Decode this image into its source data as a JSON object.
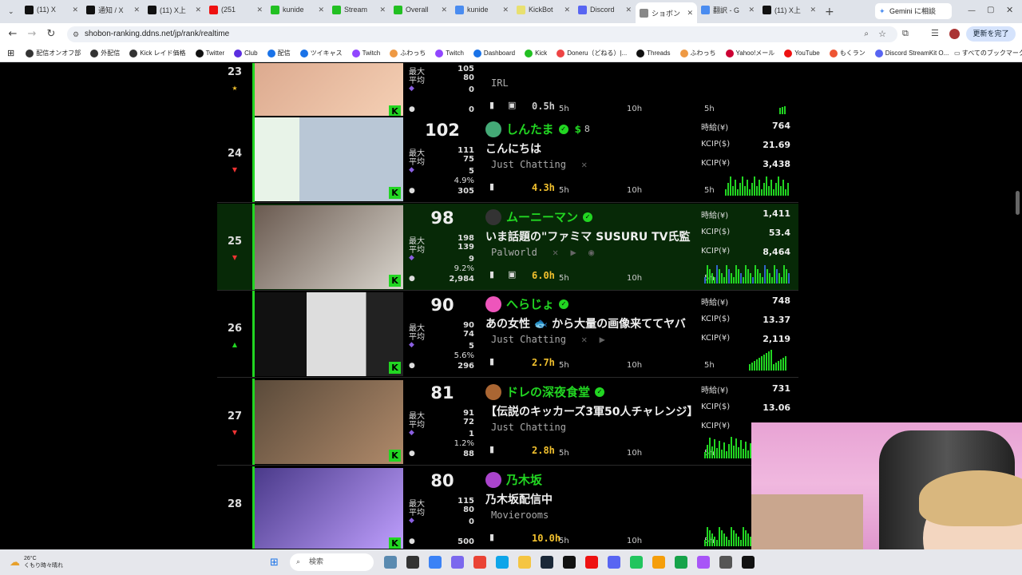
{
  "tabs": [
    {
      "label": "(11) X",
      "icon": "x-icon",
      "color": "#111"
    },
    {
      "label": "通知 / X",
      "icon": "x-icon",
      "color": "#111"
    },
    {
      "label": "(11) X上",
      "icon": "x-icon",
      "color": "#111"
    },
    {
      "label": "(251",
      "icon": "youtube-icon",
      "color": "#e11"
    },
    {
      "label": "kunide",
      "icon": "kick-icon",
      "color": "#22c022"
    },
    {
      "label": "Stream",
      "icon": "kick-icon",
      "color": "#22c022"
    },
    {
      "label": "Overall",
      "icon": "kick-icon",
      "color": "#22c022"
    },
    {
      "label": "kunide",
      "icon": "link-icon",
      "color": "#4a8cf0"
    },
    {
      "label": "KickBot",
      "icon": "bot-icon",
      "color": "#e8e070"
    },
    {
      "label": "Discord",
      "icon": "discord-icon",
      "color": "#5865f2"
    },
    {
      "label": "ショボン",
      "icon": "shobon-icon",
      "color": "#888"
    },
    {
      "label": "翻訳 - G",
      "icon": "google-icon",
      "color": "#4a8cf0"
    },
    {
      "label": "(11) X上",
      "icon": "x-icon",
      "color": "#111"
    }
  ],
  "gemini_label": "Gemini に相談",
  "update_label": "更新を完了",
  "url": "shobon-ranking.ddns.net/jp/rank/realtime",
  "bookmarks": [
    "配信オンオフ部",
    "外配信",
    "Kick レイド価格",
    "Twitter",
    "Club",
    "配信",
    "ツイキャス",
    "Twitch",
    "ふわっち",
    "Twitch",
    "Dashboard",
    "Kick",
    "Doneru（どねる）|...",
    "Threads",
    "ふわっち",
    "Yahoo!メール",
    "YouTube",
    "もくラン",
    "Discord StreamKit O..."
  ],
  "all_bookmarks": "すべてのブックマーク",
  "labels": {
    "max": "最大",
    "avg": "平均",
    "jihou": "時給(¥)",
    "kcip_usd": "KCIP($)",
    "kcip_yen": "KCIP(¥)",
    "t5h": "5h",
    "t10h": "10h",
    "t5h2": "5h"
  },
  "rows": [
    {
      "rank": "23",
      "arrow": "★",
      "arrow_color": "#f2c12e",
      "viewers": "",
      "max": "105",
      "avg": "80",
      "subs": "0",
      "pct": "",
      "chat": "0",
      "name": "",
      "title": "",
      "category": "IRL",
      "duration": "0.5h",
      "jihou": "",
      "kcip_usd": "",
      "kcip_yen": "",
      "sub_count": ""
    },
    {
      "rank": "24",
      "arrow": "▼",
      "arrow_color": "#e33",
      "viewers": "102",
      "max": "111",
      "avg": "75",
      "subs": "5",
      "pct": "4.9%",
      "chat": "305",
      "name": "しんたま",
      "title": "こんにちは",
      "category": "Just Chatting",
      "duration": "4.3h",
      "jihou": "764",
      "kcip_usd": "21.69",
      "kcip_yen": "3,438",
      "sub_count": "8"
    },
    {
      "rank": "25",
      "arrow": "▼",
      "arrow_color": "#e33",
      "viewers": "98",
      "max": "198",
      "avg": "139",
      "subs": "9",
      "pct": "9.2%",
      "chat": "2,984",
      "name": "ムーニーマン",
      "title": "いま話題の\"ファミマ SUSURU TV氏監",
      "category": "Palworld",
      "duration": "6.0h",
      "jihou": "1,411",
      "kcip_usd": "53.4",
      "kcip_yen": "8,464",
      "sub_count": ""
    },
    {
      "rank": "26",
      "arrow": "▲",
      "arrow_color": "#22d622",
      "viewers": "90",
      "max": "90",
      "avg": "74",
      "subs": "5",
      "pct": "5.6%",
      "chat": "296",
      "name": "へらじょ",
      "title": "あの女性 🐟 から大量の画像来ててヤバ",
      "category": "Just Chatting",
      "duration": "2.7h",
      "jihou": "748",
      "kcip_usd": "13.37",
      "kcip_yen": "2,119",
      "sub_count": ""
    },
    {
      "rank": "27",
      "arrow": "▼",
      "arrow_color": "#e33",
      "viewers": "81",
      "max": "91",
      "avg": "72",
      "subs": "1",
      "pct": "1.2%",
      "chat": "88",
      "name": "ドレの深夜食堂",
      "title": "【伝説のキッカーズ3軍50人チャレンジ】",
      "category": "Just Chatting",
      "duration": "2.8h",
      "jihou": "731",
      "kcip_usd": "13.06",
      "kcip_yen": "",
      "sub_count": ""
    },
    {
      "rank": "28",
      "arrow": "",
      "arrow_color": "#e33",
      "viewers": "80",
      "max": "115",
      "avg": "80",
      "subs": "0",
      "pct": "",
      "chat": "500",
      "name": "乃木坂",
      "title": "乃木坂配信中",
      "category": "Movierooms",
      "duration": "10.0h",
      "jihou": "",
      "kcip_usd": "",
      "kcip_yen": "",
      "sub_count": ""
    }
  ],
  "taskbar": {
    "weather_temp": "26°C",
    "weather_desc": "くもり時々晴れ",
    "search": "検索"
  }
}
